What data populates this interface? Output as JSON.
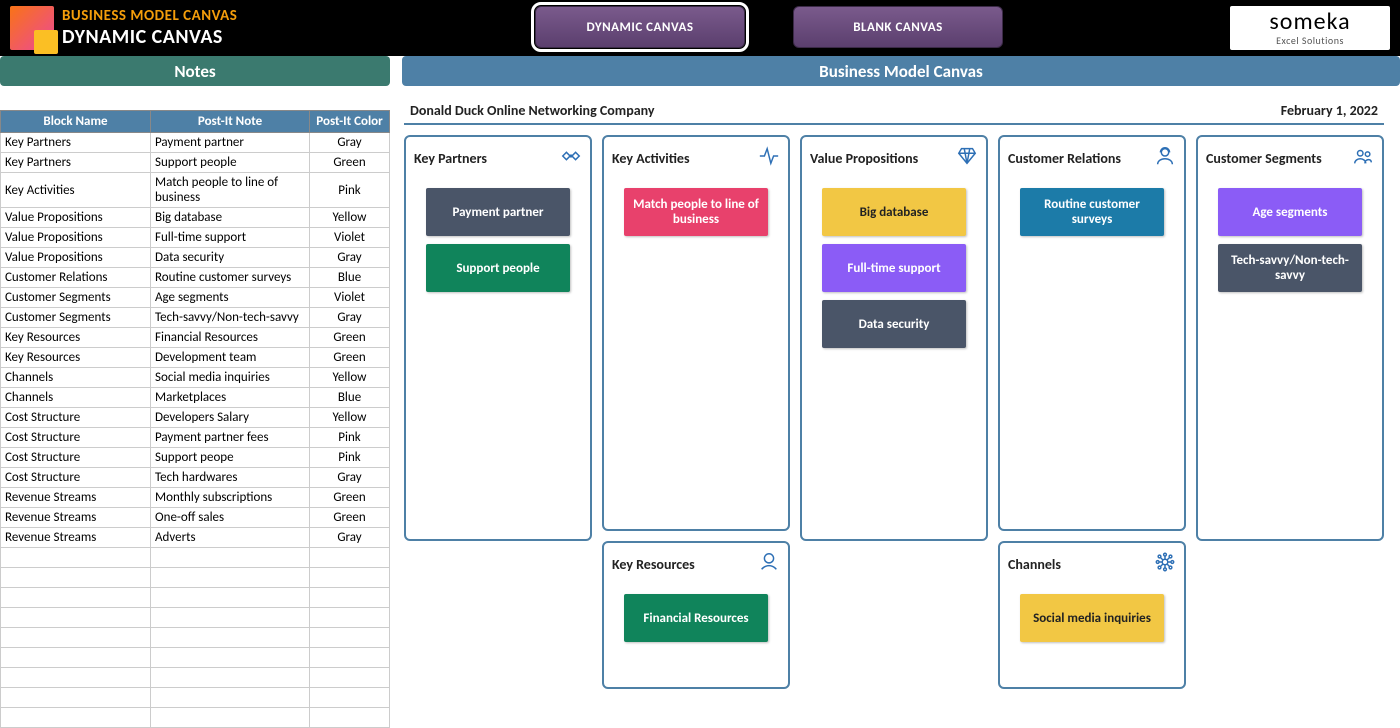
{
  "header": {
    "title1": "BUSINESS MODEL CANVAS",
    "title2": "DYNAMIC CANVAS",
    "btn_dynamic": "DYNAMIC CANVAS",
    "btn_blank": "BLANK CANVAS",
    "brand_main": "someka",
    "brand_sub": "Excel Solutions"
  },
  "sections": {
    "notes": "Notes",
    "canvas": "Business Model Canvas"
  },
  "notes_table": {
    "col_block": "Block Name",
    "col_postit": "Post-It Note",
    "col_color": "Post-It Color",
    "rows": [
      {
        "block": "Key Partners",
        "note": "Payment partner",
        "color": "Gray"
      },
      {
        "block": "Key Partners",
        "note": "Support people",
        "color": "Green"
      },
      {
        "block": "Key Activities",
        "note": "Match people to line of business",
        "color": "Pink"
      },
      {
        "block": "Value Propositions",
        "note": "Big database",
        "color": "Yellow"
      },
      {
        "block": "Value Propositions",
        "note": "Full-time support",
        "color": "Violet"
      },
      {
        "block": "Value Propositions",
        "note": "Data security",
        "color": "Gray"
      },
      {
        "block": "Customer Relations",
        "note": "Routine customer surveys",
        "color": "Blue"
      },
      {
        "block": "Customer Segments",
        "note": "Age segments",
        "color": "Violet"
      },
      {
        "block": "Customer Segments",
        "note": "Tech-savvy/Non-tech-savvy",
        "color": "Gray"
      },
      {
        "block": "Key Resources",
        "note": "Financial Resources",
        "color": "Green"
      },
      {
        "block": "Key Resources",
        "note": "Development team",
        "color": "Green"
      },
      {
        "block": "Channels",
        "note": "Social media inquiries",
        "color": "Yellow"
      },
      {
        "block": "Channels",
        "note": "Marketplaces",
        "color": "Blue"
      },
      {
        "block": "Cost Structure",
        "note": "Developers Salary",
        "color": "Yellow"
      },
      {
        "block": "Cost Structure",
        "note": "Payment partner fees",
        "color": "Pink"
      },
      {
        "block": "Cost Structure",
        "note": "Support peope",
        "color": "Pink"
      },
      {
        "block": "Cost Structure",
        "note": "Tech hardwares",
        "color": "Gray"
      },
      {
        "block": "Revenue Streams",
        "note": "Monthly subscriptions",
        "color": "Green"
      },
      {
        "block": "Revenue Streams",
        "note": "One-off sales",
        "color": "Green"
      },
      {
        "block": "Revenue Streams",
        "note": "Adverts",
        "color": "Gray"
      }
    ],
    "blank_rows": 9
  },
  "canvas": {
    "company": "Donald Duck Online Networking Company",
    "date": "February 1, 2022",
    "boxes": {
      "key_partners": {
        "title": "Key Partners",
        "icon": "handshake-icon",
        "postits": [
          {
            "label": "Payment partner",
            "cls": "c-gray"
          },
          {
            "label": "Support people",
            "cls": "c-green"
          }
        ]
      },
      "key_activities": {
        "title": "Key Activities",
        "icon": "activity-icon",
        "postits": [
          {
            "label": "Match people to line of business",
            "cls": "c-pink"
          }
        ]
      },
      "key_resources": {
        "title": "Key Resources",
        "icon": "globe-hand-icon",
        "postits": [
          {
            "label": "Financial Resources",
            "cls": "c-green"
          }
        ]
      },
      "value_propositions": {
        "title": "Value Propositions",
        "icon": "diamond-icon",
        "postits": [
          {
            "label": "Big database",
            "cls": "c-yellow dark-text"
          },
          {
            "label": "Full-time support",
            "cls": "c-violet"
          },
          {
            "label": "Data security",
            "cls": "c-gray"
          }
        ]
      },
      "customer_relations": {
        "title": "Customer Relations",
        "icon": "agent-icon",
        "postits": [
          {
            "label": "Routine customer surveys",
            "cls": "c-blue"
          }
        ]
      },
      "channels": {
        "title": "Channels",
        "icon": "network-icon",
        "postits": [
          {
            "label": "Social media inquiries",
            "cls": "c-yellow dark-text"
          }
        ]
      },
      "customer_segments": {
        "title": "Customer Segments",
        "icon": "people-icon",
        "postits": [
          {
            "label": "Age segments",
            "cls": "c-violet"
          },
          {
            "label": "Tech-savvy/Non-tech-savvy",
            "cls": "c-gray"
          }
        ]
      }
    }
  }
}
